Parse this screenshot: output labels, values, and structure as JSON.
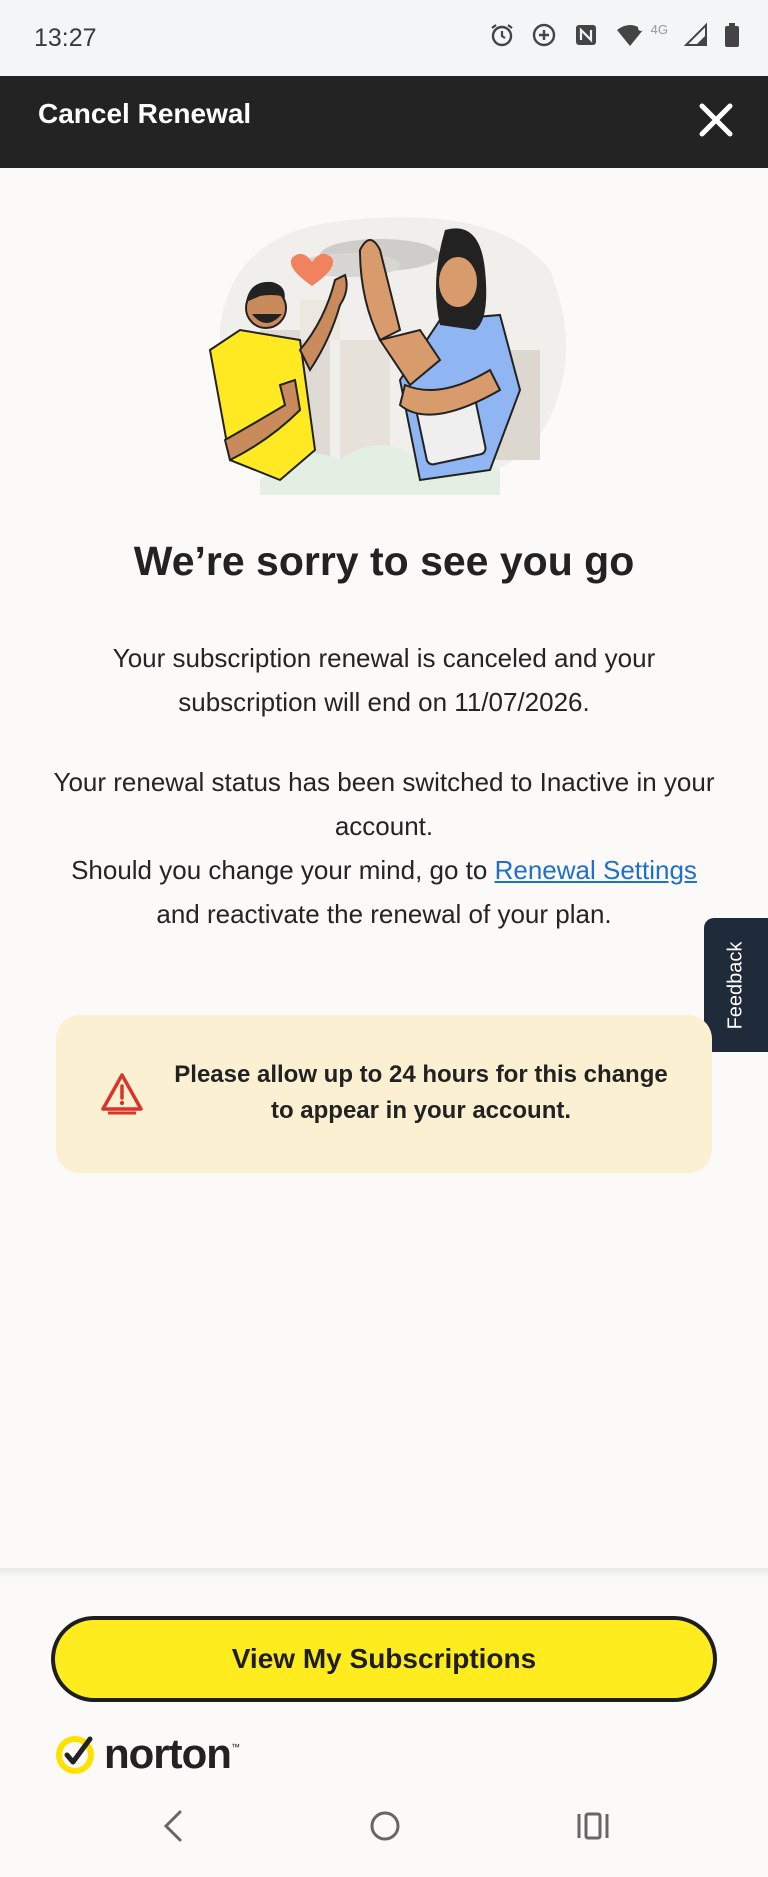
{
  "status_bar": {
    "time": "13:27",
    "network": "4G",
    "icons": [
      "alarm-icon",
      "data-saver-icon",
      "nfc-icon",
      "wifi-icon",
      "cell-signal-icon",
      "battery-icon"
    ]
  },
  "header": {
    "title": "Cancel Renewal",
    "close_icon": "close-icon"
  },
  "hero": {
    "illustration": "two-people-high-five-illustration"
  },
  "main": {
    "title": "We’re sorry to see you go",
    "paragraph1": "Your subscription renewal is canceled and your subscription will end on 11/07/2026.",
    "paragraph2_line1": "Your renewal status has been switched to Inactive in your account.",
    "paragraph2_prefix": "Should you change your mind, go to ",
    "paragraph2_link": "Renewal Settings",
    "paragraph2_suffix": " and reactivate the renewal of your plan."
  },
  "feedback": {
    "label": "Feedback"
  },
  "notice": {
    "icon": "warning-icon",
    "text": "Please allow up to 24 hours for this change to appear in your account."
  },
  "footer": {
    "button_label": "View My Subscriptions",
    "brand_name": "norton",
    "brand_tm": "™"
  },
  "nav_bar": {
    "back_icon": "back-icon",
    "home_icon": "home-icon",
    "recents_icon": "recents-icon"
  },
  "colors": {
    "header_bg": "#232323",
    "accent_yellow": "#ffec1f",
    "notice_bg": "#fbf0d2",
    "link": "#1f6fd1",
    "warning": "#d8352a",
    "feedback_bg": "#1f2a3a"
  }
}
